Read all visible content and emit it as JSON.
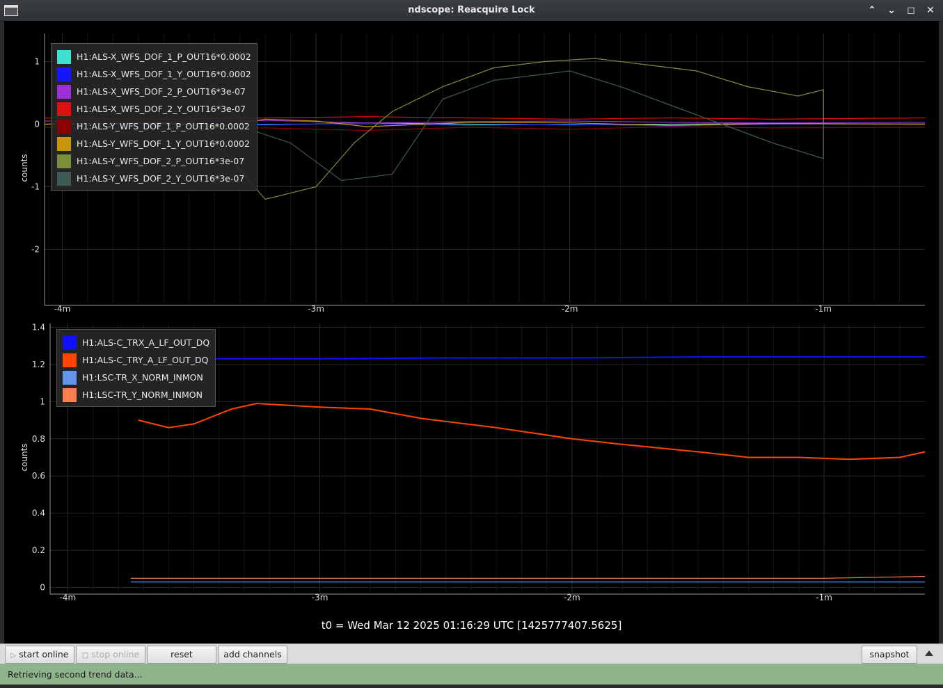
{
  "window": {
    "title": "ndscope: Reacquire Lock"
  },
  "t0_label": "t0 = Wed Mar 12 2025 01:16:29 UTC [1425777407.5625]",
  "toolbar": {
    "start_online": "start online",
    "stop_online": "stop online",
    "reset": "reset",
    "add_channels": "add channels",
    "snapshot": "snapshot"
  },
  "status": {
    "text": "Retrieving second trend data..."
  },
  "colors": {
    "background": "#000000",
    "grid": "#2a2a2a",
    "status_bg": "#8fb38a"
  },
  "chart_data": [
    {
      "type": "line",
      "title": "",
      "ylabel": "counts",
      "xlabel": "",
      "xlim": [
        -4.07,
        -0.6
      ],
      "ylim": [
        -2.85,
        1.45
      ],
      "x_ticks": [
        -4,
        -3,
        -2,
        -1
      ],
      "x_tick_labels": [
        "-4m",
        "-3m",
        "-2m",
        "-1m"
      ],
      "y_ticks": [
        1,
        0,
        -1,
        -2
      ],
      "y_tick_labels": [
        "1",
        "0",
        "-1",
        "-2"
      ],
      "grid": true,
      "legend_position": "top-left",
      "series": [
        {
          "name": "H1:ALS-X_WFS_DOF_1_P_OUT16*0.0002",
          "color": "#40e0d0",
          "x": [
            -4.07,
            -3.6,
            -3.2,
            -2.8,
            -2.4,
            -2.0,
            -1.6,
            -1.2,
            -0.6
          ],
          "y": [
            0.0,
            0.01,
            -0.01,
            0.02,
            0.0,
            -0.01,
            0.0,
            0.01,
            0.0
          ]
        },
        {
          "name": "H1:ALS-X_WFS_DOF_1_Y_OUT16*0.0002",
          "color": "#1515ff",
          "x": [
            -4.07,
            -3.6,
            -3.2,
            -2.8,
            -2.4,
            -2.0,
            -1.6,
            -1.2,
            -0.6
          ],
          "y": [
            0.0,
            -0.01,
            0.0,
            0.01,
            -0.02,
            0.0,
            -0.03,
            0.0,
            0.01
          ]
        },
        {
          "name": "H1:ALS-X_WFS_DOF_2_P_OUT16*3e-07",
          "color": "#9b30d9",
          "x": [
            -4.07,
            -3.6,
            -3.2,
            -2.8,
            -2.4,
            -2.0,
            -1.6,
            -1.2,
            -0.6
          ],
          "y": [
            0.05,
            0.03,
            0.06,
            0.02,
            0.04,
            0.05,
            0.03,
            0.02,
            0.03
          ]
        },
        {
          "name": "H1:ALS-X_WFS_DOF_2_Y_OUT16*3e-07",
          "color": "#e01010",
          "x": [
            -4.07,
            -3.6,
            -3.2,
            -2.8,
            -2.4,
            -2.0,
            -1.6,
            -1.2,
            -0.6
          ],
          "y": [
            0.1,
            0.08,
            0.1,
            0.12,
            0.1,
            0.08,
            0.1,
            0.08,
            0.1
          ]
        },
        {
          "name": "H1:ALS-Y_WFS_DOF_1_P_OUT16*0.0002",
          "color": "#8b0000",
          "x": [
            -4.07,
            -3.6,
            -3.2,
            -2.8,
            -2.4,
            -2.0,
            -1.6,
            -1.2,
            -0.6
          ],
          "y": [
            -0.05,
            -0.08,
            -0.06,
            -0.1,
            -0.05,
            -0.08,
            -0.04,
            -0.06,
            -0.05
          ]
        },
        {
          "name": "H1:ALS-Y_WFS_DOF_1_Y_OUT16*0.0002",
          "color": "#c8960a",
          "x": [
            -4.07,
            -3.6,
            -3.4,
            -3.2,
            -3.0,
            -2.8,
            -2.4,
            -2.0,
            -1.6,
            -1.2,
            -0.6
          ],
          "y": [
            0.0,
            0.02,
            -0.05,
            0.08,
            0.05,
            -0.04,
            0.03,
            0.02,
            -0.02,
            0.01,
            0.0
          ]
        },
        {
          "name": "H1:ALS-Y_WFS_DOF_2_P_OUT16*3e-07",
          "color": "#7a8f3c",
          "x": [
            -3.5,
            -3.35,
            -3.2,
            -3.0,
            -2.85,
            -2.7,
            -2.5,
            -2.3,
            -2.1,
            -1.9,
            -1.7,
            -1.5,
            -1.3,
            -1.1,
            -1.0,
            -1.0
          ],
          "y": [
            0.1,
            -0.5,
            -1.2,
            -1.0,
            -0.3,
            0.2,
            0.6,
            0.9,
            1.0,
            1.05,
            0.95,
            0.85,
            0.6,
            0.45,
            0.55,
            -0.55
          ]
        },
        {
          "name": "H1:ALS-Y_WFS_DOF_2_Y_OUT16*3e-07",
          "color": "#3e5a55",
          "x": [
            -3.5,
            -3.4,
            -3.25,
            -3.1,
            -2.9,
            -2.7,
            -2.5,
            -2.3,
            -2.0,
            -1.8,
            -1.6,
            -1.4,
            -1.2,
            -1.0,
            -1.0
          ],
          "y": [
            0.0,
            0.45,
            -0.1,
            -0.3,
            -0.9,
            -0.8,
            0.4,
            0.7,
            0.85,
            0.6,
            0.3,
            0.0,
            -0.3,
            -0.55,
            0.0
          ]
        }
      ]
    },
    {
      "type": "line",
      "title": "",
      "ylabel": "counts",
      "xlabel": "",
      "xlim": [
        -4.07,
        -0.6
      ],
      "ylim": [
        -0.02,
        1.42
      ],
      "x_ticks": [
        -4,
        -3,
        -2,
        -1
      ],
      "x_tick_labels": [
        "-4m",
        "-3m",
        "-2m",
        "-1m"
      ],
      "y_ticks": [
        1.4,
        1.2,
        1,
        0.8,
        0.6,
        0.4,
        0.2,
        0
      ],
      "y_tick_labels": [
        "1.4",
        "1.2",
        "1",
        "0.8",
        "0.6",
        "0.4",
        "0.2",
        "0"
      ],
      "grid": true,
      "legend_position": "top-left",
      "series": [
        {
          "name": "H1:ALS-C_TRX_A_LF_OUT_DQ",
          "color": "#1010ff",
          "x": [
            -3.5,
            -3.0,
            -2.5,
            -2.0,
            -1.5,
            -1.0,
            -0.6
          ],
          "y": [
            1.23,
            1.23,
            1.235,
            1.235,
            1.24,
            1.24,
            1.24
          ]
        },
        {
          "name": "H1:ALS-C_TRY_A_LF_OUT_DQ",
          "color": "#ff4500",
          "x": [
            -3.72,
            -3.6,
            -3.5,
            -3.35,
            -3.25,
            -3.0,
            -2.8,
            -2.6,
            -2.3,
            -2.0,
            -1.8,
            -1.5,
            -1.3,
            -1.1,
            -0.9,
            -0.7,
            -0.6
          ],
          "y": [
            0.9,
            0.86,
            0.88,
            0.96,
            0.99,
            0.97,
            0.96,
            0.91,
            0.86,
            0.8,
            0.77,
            0.73,
            0.7,
            0.7,
            0.69,
            0.7,
            0.73
          ]
        },
        {
          "name": "H1:LSC-TR_X_NORM_INMON",
          "color": "#6495ed",
          "x": [
            -3.75,
            -3.0,
            -2.0,
            -1.0,
            -0.6
          ],
          "y": [
            0.03,
            0.03,
            0.03,
            0.03,
            0.03
          ]
        },
        {
          "name": "H1:LSC-TR_Y_NORM_INMON",
          "color": "#ff7f50",
          "x": [
            -3.75,
            -3.0,
            -2.0,
            -1.0,
            -0.6
          ],
          "y": [
            0.05,
            0.05,
            0.05,
            0.05,
            0.06
          ]
        }
      ]
    }
  ]
}
